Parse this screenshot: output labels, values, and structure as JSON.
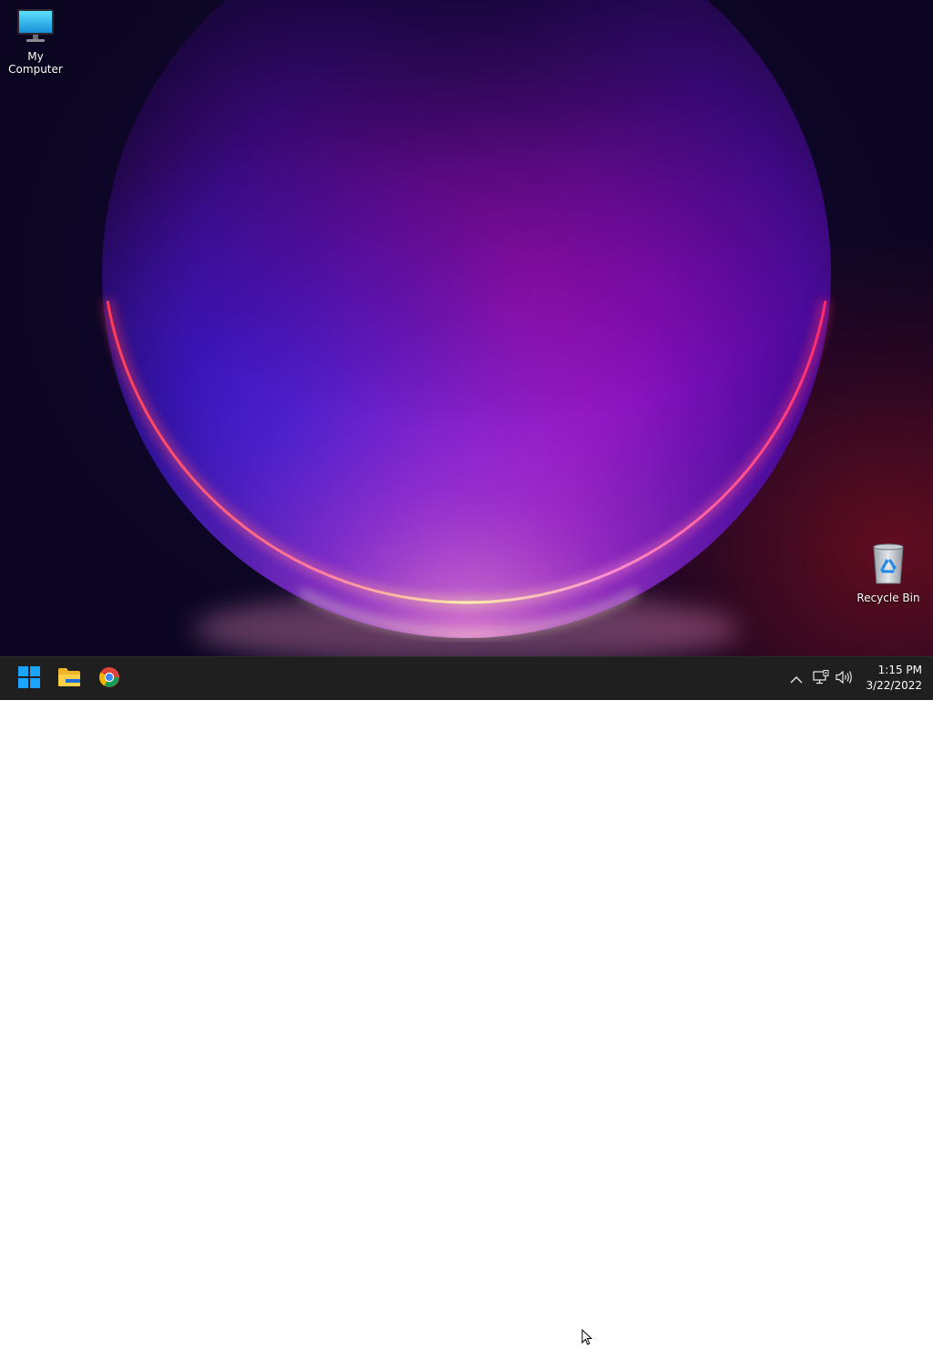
{
  "desktop": {
    "icons": [
      {
        "label": "My Computer",
        "icon": "monitor-icon"
      },
      {
        "label": "Recycle Bin",
        "icon": "recycle-bin-icon"
      }
    ]
  },
  "taskbar": {
    "apps": [
      {
        "icon": "windows-start-icon"
      },
      {
        "icon": "file-explorer-icon"
      },
      {
        "icon": "chrome-icon"
      }
    ],
    "tray": {
      "icons": [
        "chevron-up-icon",
        "network-icon",
        "volume-icon"
      ]
    },
    "clock": {
      "time": "1:15 PM",
      "date": "3/22/2022"
    }
  },
  "colors": {
    "taskbar_bg": "#1f1f1f",
    "desktop_bg": "#0b0522",
    "start_blue": "#1aa3ff"
  }
}
